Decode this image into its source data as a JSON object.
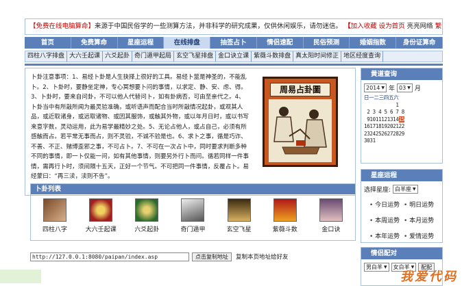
{
  "topbar": {
    "free": "【免费在线电脑算命】",
    "desc": "来源于中国民俗学的一些测算方法，并非科学的研究成果，仅供休闲娱乐，请勿迷信。",
    "bracket_open": "【",
    "favorite": "加入收藏",
    "homepage": "设为首页",
    "site": "亮亮网络",
    "lang": "繁體中文",
    "bracket_close": "】"
  },
  "nav": [
    "首页",
    "免费算命",
    "星座运程",
    "在线排盘",
    "抽签占卜",
    "情侣速配",
    "民俗预测",
    "婚姻指数",
    "身份证算命"
  ],
  "nav_active": 3,
  "subnav": [
    "四柱八字排盘",
    "大六壬起课",
    "六爻起卦",
    "奇门遁甲起局",
    "玄空飞星排盘",
    "金口诀立课",
    "紫薇斗数排盘",
    "真太阳时间修正",
    "地区经度查询"
  ],
  "notes": "卜卦注意事项：1、易经卜卦是人生抉择上很好的工具。易经卜筮是神圣的，不能乱卜。2、卜卦时，要静坐定神，专心冥想要卜问的事情，以求定、静、安、虑、得。3、卜卦时，要来自问卦，不可以他人代替问卜，如有卦病否，可由至亲代之。4、卜卦当中有所敲所闻为最灵验准确，或听语声而配合当时所敲情况起卦，或观其人品，或近取诸身，或远取诸物、或因其服饰，或触其外物，或以年月日时，或以书写来意字数，灵动运用，此为易学最精妙之处。5、无论占他人，或占自己，必须有所感触而占。若平常无事而占，则不灵验，不诚不验是也。6、求卜之事，循是巧诈、不善、不正、赌博歪邪之事，不可占卜。7、不可在一次占卜中，同时要求判断多种不同的事情，即一卜仅能一问，如有其他事情，则要另外行卜而问。循若同样一件事情，需再行卜时，须间隔十五天，正好一个节气。不可把同一件事情，反覆占卜。易经蒙曰：“再三渎，渎则不告”。",
  "picture_title": "周易占卦圖",
  "list": {
    "title": "卜卦列表",
    "items": [
      "四柱八字",
      "大六壬起课",
      "六爻起卦",
      "奇门遁甲",
      "玄空飞星",
      "紫薇斗数",
      "金口诀"
    ],
    "colors": [
      "#7a4a2a",
      "#a02020",
      "#2c6a2c",
      "#555555",
      "#8a6a30",
      "#b01818",
      "#6a4a70"
    ]
  },
  "address": {
    "url": "http://127.0.0.1:8080/paipan/index.asp",
    "copy_button": "点击复制地址",
    "copy_hint": "复制本页地址给好友"
  },
  "calendar": {
    "title": "黄道查询",
    "year": "2014",
    "year_label": "年",
    "month": "03",
    "month_label": "月",
    "header": "日一二三四五六",
    "rows": [
      "           1",
      " 2 3 4 5 6 7 8",
      " 910111213",
      "16171819202122",
      "23242526272829",
      "3031"
    ],
    "today": "15",
    "row3_tail": "14"
  },
  "horoscope": {
    "title": "星座运程",
    "select_label": "选择星座:",
    "select_value": "白羊座",
    "items": [
      "今日运势",
      "明日运势",
      "本周运势",
      "本月运势",
      "本年运势",
      "爱情运势"
    ]
  },
  "match": {
    "title": "情侣配对",
    "left_value": "男白羊",
    "right_value": "女白羊",
    "button": "配配"
  },
  "watermark": "我爱代码"
}
